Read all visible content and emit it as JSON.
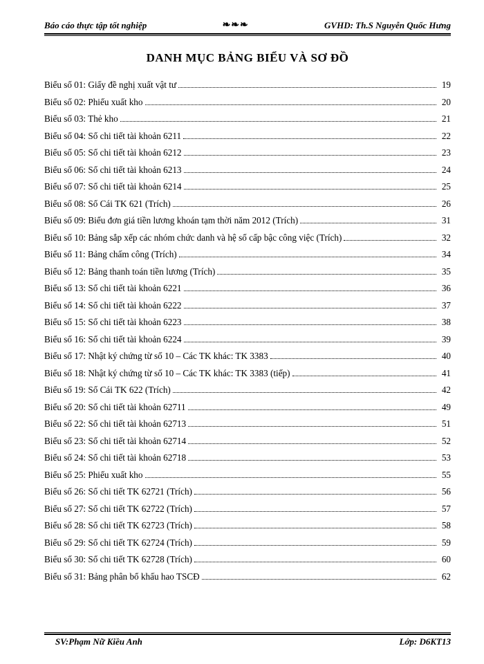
{
  "header": {
    "left": "Báo cáo thực tập tốt nghiệp",
    "center": "❧❧❧",
    "right": "GVHD: Th.S Nguyễn Quốc Hưng"
  },
  "title": "DANH MỤC BẢNG BIỂU VÀ SƠ ĐỒ",
  "toc": [
    {
      "label": "Biểu số 01: Giấy đề nghị xuất vật tư",
      "page": "19"
    },
    {
      "label": "Biểu số 02: Phiếu xuất kho",
      "page": "20"
    },
    {
      "label": "Biểu số 03: Thẻ kho",
      "page": "21"
    },
    {
      "label": "Biểu số 04: Sổ chi tiết tài khoản 6211",
      "page": "22"
    },
    {
      "label": "Biểu số 05: Sổ chi tiết tài khoản 6212",
      "page": "23"
    },
    {
      "label": "Biểu số 06: Sổ chi tiết tài khoản 6213",
      "page": "24"
    },
    {
      "label": "Biểu số 07: Sổ chi tiết tài khoản 6214",
      "page": "25"
    },
    {
      "label": "Biểu số 08: Sổ Cái TK 621 (Trích)",
      "page": "26"
    },
    {
      "label": "Biểu số 09: Biểu đơn giá tiền lương khoán tạm thời năm 2012 (Trích)",
      "page": "31"
    },
    {
      "label": "Biểu số 10: Bảng sắp xếp các nhóm chức danh và hệ số cấp bậc công việc (Trích)",
      "page": "32"
    },
    {
      "label": "Biểu số 11: Bảng chấm công (Trích)",
      "page": "34"
    },
    {
      "label": "Biểu số 12: Bảng thanh toán tiền lương (Trích)",
      "page": "35"
    },
    {
      "label": "Biểu số 13: Sổ chi tiết tài khoản 6221",
      "page": "36"
    },
    {
      "label": "Biểu số 14: Sổ chi tiết tài khoản 6222",
      "page": "37"
    },
    {
      "label": "Biểu số 15: Sổ chi tiết tài khoản 6223",
      "page": "38"
    },
    {
      "label": "Biểu số 16: Sổ chi tiết tài khoản 6224",
      "page": "39"
    },
    {
      "label": "Biểu số 17: Nhật ký chứng từ số 10 – Các TK khác: TK 3383",
      "page": "40"
    },
    {
      "label": "Biểu số 18: Nhật ký chứng từ số 10 – Các TK khác: TK 3383 (tiếp)",
      "page": "41"
    },
    {
      "label": "Biểu số 19: Sổ Cái TK 622 (Trích)",
      "page": "42"
    },
    {
      "label": "Biểu số 20: Sổ chi tiết tài khoản 62711",
      "page": "49"
    },
    {
      "label": "Biểu số 22: Sổ chi tiết tài khoản 62713",
      "page": "51"
    },
    {
      "label": "Biểu số 23: Sổ chi tiết tài khoản 62714",
      "page": "52"
    },
    {
      "label": "Biểu số 24: Sổ chi tiết tài khoản 62718",
      "page": "53"
    },
    {
      "label": "Biểu số 25: Phiếu xuất kho",
      "page": "55"
    },
    {
      "label": "Biểu số 26: Sổ chi tiết TK 62721 (Trích)",
      "page": "56"
    },
    {
      "label": "Biểu số 27: Sổ chi tiết TK 62722 (Trích)",
      "page": "57"
    },
    {
      "label": "Biểu số 28: Sổ chi tiết TK 62723 (Trích)",
      "page": "58"
    },
    {
      "label": "Biểu số 29: Sổ chi tiết TK 62724 (Trích)",
      "page": "59"
    },
    {
      "label": "Biểu số 30: Sổ chi tiết TK 62728 (Trích)",
      "page": "60"
    },
    {
      "label": "Biểu số 31: Bảng phân bổ khấu hao TSCĐ",
      "page": "62"
    }
  ],
  "footer": {
    "left": "SV:Phạm Nữ Kiều Anh",
    "right": "Lớp: D6KT13"
  }
}
